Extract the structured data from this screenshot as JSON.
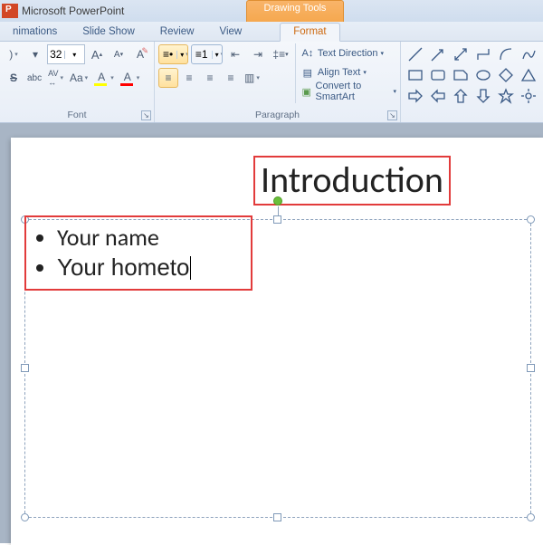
{
  "titlebar": {
    "app_name": "Microsoft PowerPoint"
  },
  "contextual_tab": {
    "group_label": "Drawing Tools",
    "tab_label": "Format"
  },
  "tabs": {
    "animations": "nimations",
    "slideshow": "Slide Show",
    "review": "Review",
    "view": "View",
    "format": "Format"
  },
  "ribbon": {
    "font": {
      "size_value": "32",
      "group_label": "Font",
      "highlight_color": "#ffff00",
      "font_color": "#ff0000"
    },
    "paragraph": {
      "group_label": "Paragraph",
      "text_direction": "Text Direction",
      "align_text": "Align Text",
      "convert_smartart": "Convert to SmartArt"
    }
  },
  "slide": {
    "title": "Introduction",
    "bullets": [
      "Your name",
      "Your hometo"
    ]
  }
}
